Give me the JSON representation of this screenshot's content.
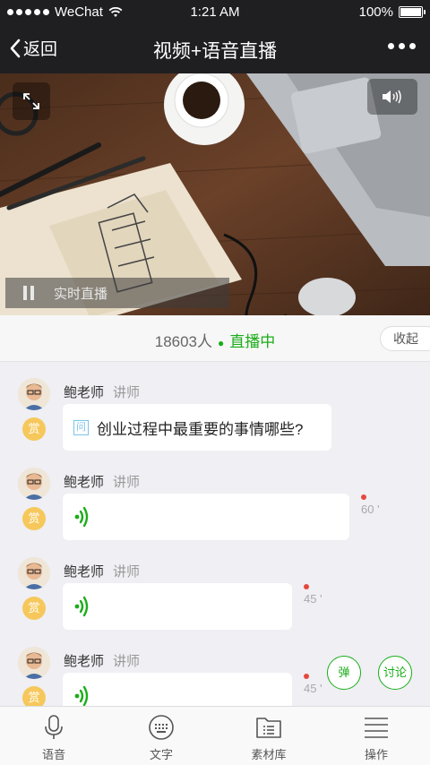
{
  "status_bar": {
    "carrier": "WeChat",
    "time": "1:21 AM",
    "battery": "100%"
  },
  "nav": {
    "back_label": "返回",
    "title": "视频+语音直播"
  },
  "video": {
    "live_label": "实时直播"
  },
  "info_bar": {
    "viewers": "18603人",
    "status": "直播中",
    "collapse_label": "收起"
  },
  "messages": [
    {
      "sender": "鲍老师",
      "role": "讲师",
      "type": "text",
      "badge": "问",
      "text": "创业过程中最重要的事情哪些?",
      "reward": "赏"
    },
    {
      "sender": "鲍老师",
      "role": "讲师",
      "type": "voice",
      "duration": "60 '",
      "reward": "赏"
    },
    {
      "sender": "鲍老师",
      "role": "讲师",
      "type": "voice",
      "duration": "45 '",
      "reward": "赏"
    },
    {
      "sender": "鲍老师",
      "role": "讲师",
      "type": "voice",
      "duration": "45 '",
      "reward": "赏"
    }
  ],
  "float_buttons": {
    "danmaku": "弹",
    "discuss": "讨论"
  },
  "tabs": [
    {
      "label": "语音",
      "icon": "microphone-icon"
    },
    {
      "label": "文字",
      "icon": "keyboard-icon"
    },
    {
      "label": "素材库",
      "icon": "folder-icon"
    },
    {
      "label": "操作",
      "icon": "list-icon"
    }
  ],
  "colors": {
    "accent": "#1aad19",
    "nav_bg": "#1f1f22",
    "reward": "#f6c85c",
    "unread": "#e5483e"
  }
}
